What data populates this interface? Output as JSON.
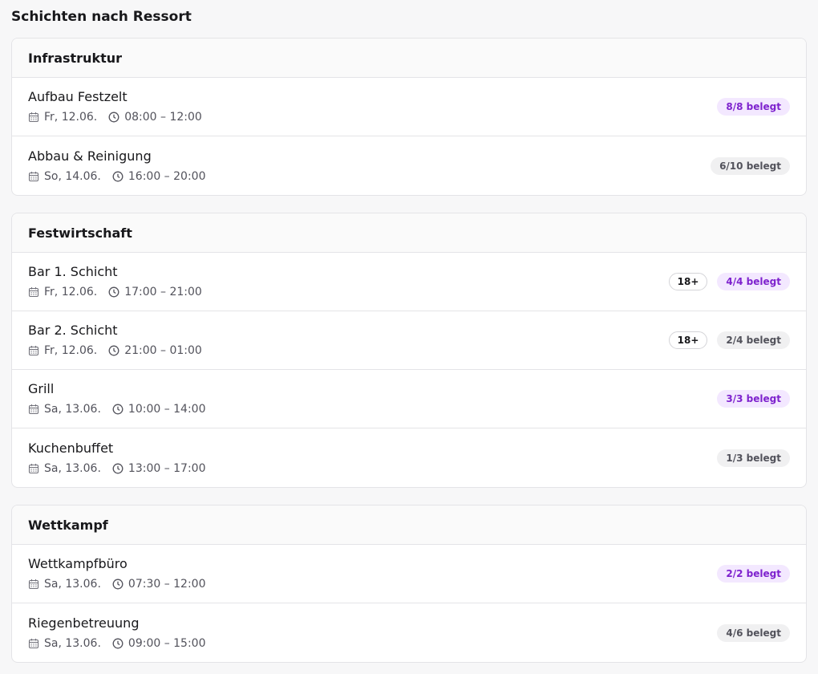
{
  "page": {
    "title": "Schichten nach Ressort"
  },
  "groups": [
    {
      "title": "Infrastruktur",
      "shifts": [
        {
          "name": "Aufbau Festzelt",
          "date": "Fr, 12.06.",
          "time": "08:00 – 12:00",
          "status": "8/8 belegt",
          "full": true,
          "age": ""
        },
        {
          "name": "Abbau & Reinigung",
          "date": "So, 14.06.",
          "time": "16:00 – 20:00",
          "status": "6/10 belegt",
          "full": false,
          "age": ""
        }
      ]
    },
    {
      "title": "Festwirtschaft",
      "shifts": [
        {
          "name": "Bar 1. Schicht",
          "date": "Fr, 12.06.",
          "time": "17:00 – 21:00",
          "status": "4/4 belegt",
          "full": true,
          "age": "18+"
        },
        {
          "name": "Bar 2. Schicht",
          "date": "Fr, 12.06.",
          "time": "21:00 – 01:00",
          "status": "2/4 belegt",
          "full": false,
          "age": "18+"
        },
        {
          "name": "Grill",
          "date": "Sa, 13.06.",
          "time": "10:00 – 14:00",
          "status": "3/3 belegt",
          "full": true,
          "age": ""
        },
        {
          "name": "Kuchenbuffet",
          "date": "Sa, 13.06.",
          "time": "13:00 – 17:00",
          "status": "1/3 belegt",
          "full": false,
          "age": ""
        }
      ]
    },
    {
      "title": "Wettkampf",
      "shifts": [
        {
          "name": "Wettkampfbüro",
          "date": "Sa, 13.06.",
          "time": "07:30 – 12:00",
          "status": "2/2 belegt",
          "full": true,
          "age": ""
        },
        {
          "name": "Riegenbetreuung",
          "date": "Sa, 13.06.",
          "time": "09:00 – 15:00",
          "status": "4/6 belegt",
          "full": false,
          "age": ""
        }
      ]
    }
  ],
  "icons": {
    "date": "calendar-icon",
    "time": "clock-icon"
  },
  "colors": {
    "full_badge_bg": "#f3e8ff",
    "full_badge_text": "#7e22ce",
    "open_badge_bg": "#f0f0f1",
    "open_badge_text": "#52525b"
  }
}
